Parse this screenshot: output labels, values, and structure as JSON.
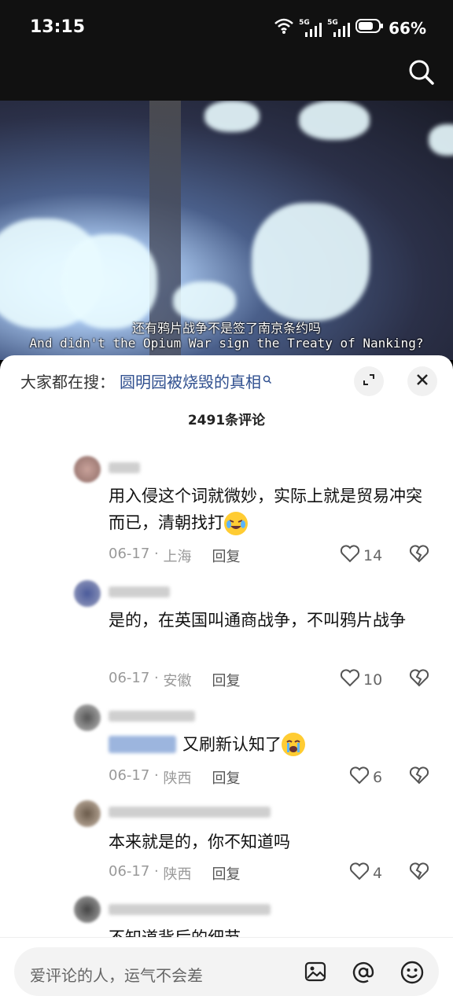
{
  "status": {
    "time": "13:15",
    "battery": "66%",
    "net1": "5G",
    "net2": "5G"
  },
  "video": {
    "subtitle_cn": "还有鸦片战争不是签了南京条约吗",
    "subtitle_en": "And didn't the Opium War sign the Treaty of Nanking?"
  },
  "sheet": {
    "hot_label": "大家都在搜：",
    "hot_term": "圆明园被烧毁的真相",
    "count": "2491条评论"
  },
  "comments": [
    {
      "text": "用入侵这个词就微妙，实际上就是贸易冲突而已，清朝找打",
      "date": "06-17",
      "location": "上海",
      "reply": "回复",
      "likes": "14"
    },
    {
      "text": "是的，在英国叫通商战争，不叫鸦片战争",
      "date": "06-17",
      "location": "安徽",
      "reply": "回复",
      "likes": "10"
    },
    {
      "text": "又刷新认知了",
      "date": "06-17",
      "location": "陕西",
      "reply": "回复",
      "likes": "6"
    },
    {
      "text": "本来就是的，你不知道吗",
      "date": "06-17",
      "location": "陕西",
      "reply": "回复",
      "likes": "4"
    },
    {
      "text": "不知道背后的细节"
    }
  ],
  "input": {
    "placeholder": "爱评论的人，运气不会差"
  },
  "colors": {
    "accent_link": "#2f4f8f",
    "meta_gray": "#999999"
  }
}
